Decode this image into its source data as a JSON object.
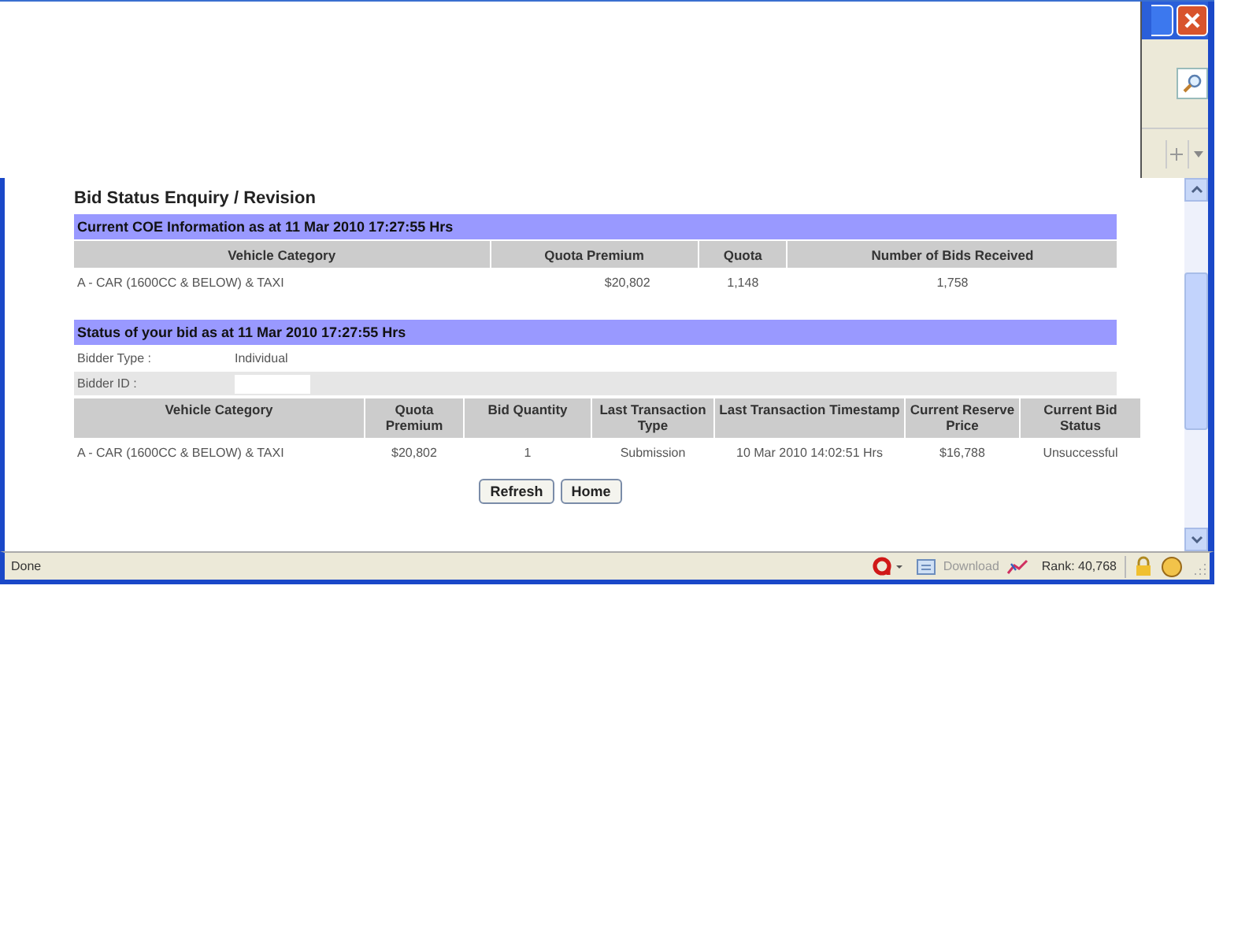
{
  "page": {
    "title": "Bid Status Enquiry / Revision"
  },
  "coe_info": {
    "heading": "Current COE Information as at 11 Mar 2010 17:27:55 Hrs",
    "columns": [
      "Vehicle Category",
      "Quota Premium",
      "Quota",
      "Number of Bids Received"
    ],
    "rows": [
      [
        "A - CAR (1600CC & BELOW) & TAXI",
        "$20,802",
        "1,148",
        "1,758"
      ]
    ]
  },
  "bid_status": {
    "heading": "Status of your bid as at 11 Mar 2010 17:27:55 Hrs",
    "fields": [
      {
        "label": "Bidder Type :",
        "kind": "text",
        "value": "Individual"
      },
      {
        "label": "Bidder ID :",
        "kind": "input"
      }
    ],
    "columns": [
      "Vehicle Category",
      "Quota Premium",
      "Bid Quantity",
      "Last Transaction Type",
      "Last Transaction Timestamp",
      "Current Reserve Price",
      "Current Bid Status"
    ],
    "rows": [
      [
        "A - CAR (1600CC & BELOW) & TAXI",
        "$20,802",
        "1",
        "Submission",
        "10 Mar 2010 14:02:51 Hrs",
        "$16,788",
        "Unsuccessful"
      ]
    ]
  },
  "buttons": [
    "Refresh",
    "Home"
  ],
  "status_bar": {
    "text": "Done",
    "download": {
      "label": "Download",
      "disabled": true
    },
    "rank": "Rank: 40,768"
  }
}
